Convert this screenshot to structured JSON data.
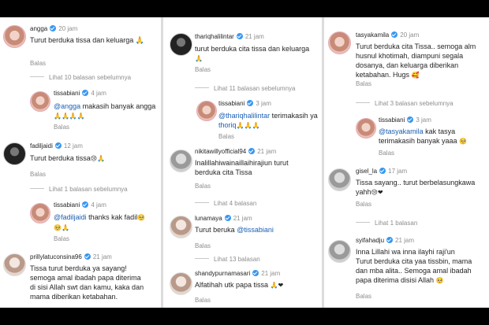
{
  "reply_label": "Balas",
  "col1": {
    "c1": {
      "user": "angga",
      "time": "20 jam",
      "text": "Turut berduka tissa dan keluarga 🙏"
    },
    "more1": "Lihat 10 balasan sebelumnya",
    "r1": {
      "user": "tissabiani",
      "time": "4 jam",
      "mention": "@angga",
      "text": " makasih banyak angga",
      "emoji": "🙏🙏🙏🙏"
    },
    "c2": {
      "user": "fadiljaidi",
      "time": "12 jam",
      "text": "Turut berduka tissa",
      "emoji": "😢🙏"
    },
    "more2": "Lihat 1 balasan sebelumnya",
    "r2": {
      "user": "tissabiani",
      "time": "4 jam",
      "mention": "@fadiljaidi",
      "text": " thanks kak fadil",
      "emoji1": "🥺",
      "emoji2": "🥺🙏"
    },
    "c3": {
      "user": "prillylatuconsina96",
      "time": "21 jam",
      "lines": [
        "Tissa turut berduka ya sayang!",
        "semoga amal ibadah papa diterima",
        "di sisi Allah swt dan kamu, kaka dan",
        "mama diberikan ketabahan."
      ]
    }
  },
  "col2": {
    "c1": {
      "user": "thariqhalilintar",
      "time": "21 jam",
      "text": "turut berduka cita tissa dan keluarga",
      "emoji": "🙏"
    },
    "more1": "Lihat 11 balasan sebelumnya",
    "r1": {
      "user": "tissabiani",
      "time": "3 jam",
      "mention": "@thariqhalilintar",
      "text": " terimakasih ya",
      "mention2": "thoriq",
      "emoji": "🙏🙏🙏"
    },
    "c2": {
      "user": "nikitawillyofficial94",
      "time": "21 jam",
      "lines": [
        "Inalillahiwainaillaihirajiun turut",
        "berduka cita Tissa"
      ]
    },
    "more2": "Lihat 4 balasan",
    "c3": {
      "user": "lunamaya",
      "time": "21 jam",
      "text": "Turut beruka ",
      "mention": "@tissabiani"
    },
    "more3": "Lihat 13 balasan",
    "c4": {
      "user": "shandypurnamasari",
      "time": "21 jam",
      "text": "Alfatihah utk papa tissa ",
      "emoji": "🙏❤"
    }
  },
  "col3": {
    "c1": {
      "user": "tasyakamila",
      "time": "20 jam",
      "lines": [
        "Turut berduka cita Tissa.. semoga alm",
        "husnul khotimah, diampuni segala",
        "dosanya, dan keluarga diberikan",
        "ketabahan. Hugs"
      ],
      "emoji": "🥰"
    },
    "more1": "Lihat 3 balasan sebelumnya",
    "r1": {
      "user": "tissabiani",
      "time": "3 jam",
      "mention": "@tasyakamila",
      "text": " kak tasya",
      "line2": "terimakasih banyak yaaa",
      "emoji": "🥺"
    },
    "c2": {
      "user": "gisel_la",
      "time": "17 jam",
      "line1": "Tissa sayang.. turut berbelasungkawa",
      "line2": "yahh",
      "emoji": "😢❤"
    },
    "more2": "Lihat 1 balasan",
    "c3": {
      "user": "syifahadju",
      "time": "21 jam",
      "lines": [
        "Inna Lillahi wa inna ilayhi raji'un",
        "Turut berduka cita yaa tissbin, mama",
        "dan mba alita.. Semoga amal ibadah",
        "papa diterima disisi Allah"
      ],
      "emoji": "🥺"
    }
  }
}
